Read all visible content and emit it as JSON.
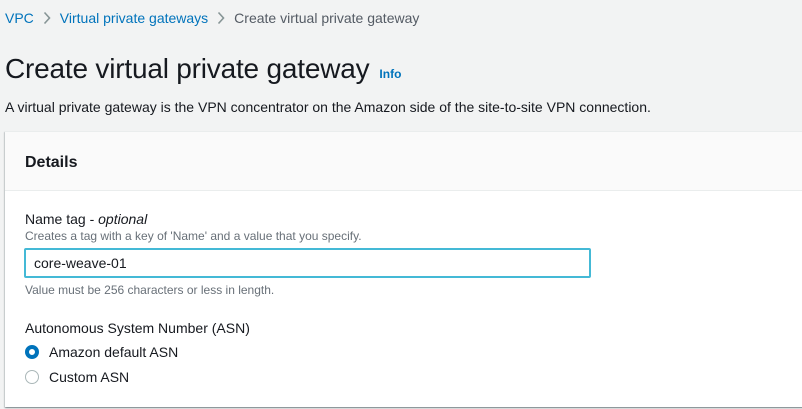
{
  "breadcrumb": {
    "items": [
      {
        "label": "VPC"
      },
      {
        "label": "Virtual private gateways"
      },
      {
        "label": "Create virtual private gateway"
      }
    ]
  },
  "header": {
    "title": "Create virtual private gateway",
    "info_label": "Info",
    "description": "A virtual private gateway is the VPN concentrator on the Amazon side of the site-to-site VPN connection."
  },
  "details": {
    "title": "Details",
    "name_tag": {
      "label": "Name tag - ",
      "label_optional": "optional",
      "description": "Creates a tag with a key of 'Name' and a value that you specify.",
      "value": "core-weave-01",
      "constraint": "Value must be 256 characters or less in length."
    },
    "asn": {
      "label": "Autonomous System Number (ASN)",
      "options": [
        {
          "label": "Amazon default ASN",
          "selected": true
        },
        {
          "label": "Custom ASN",
          "selected": false
        }
      ]
    }
  },
  "colors": {
    "link": "#0073bb",
    "focus_border": "#44b9d6",
    "radio_selected": "#0073bb"
  },
  "icons": {
    "breadcrumb_separator": "chevron-right-icon"
  }
}
